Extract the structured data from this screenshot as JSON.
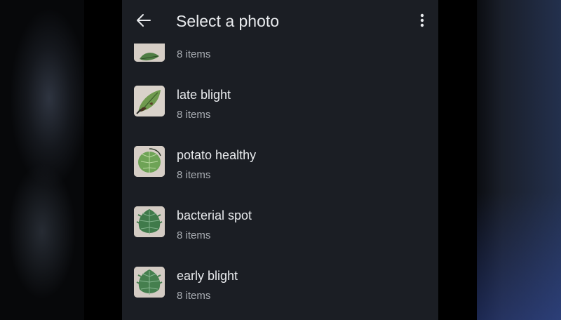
{
  "appbar": {
    "title": "Select a photo",
    "back_icon": "arrow-left-icon",
    "more_icon": "more-vert-icon"
  },
  "albums": [
    {
      "name": "",
      "count": "8 items",
      "thumb": "leaf-partial"
    },
    {
      "name": "late blight",
      "count": "8 items",
      "thumb": "leaf-late-blight"
    },
    {
      "name": "potato healthy",
      "count": "8 items",
      "thumb": "leaf-potato-healthy"
    },
    {
      "name": "bacterial spot",
      "count": "8 items",
      "thumb": "leaf-bacterial-spot"
    },
    {
      "name": "early blight",
      "count": "8 items",
      "thumb": "leaf-early-blight"
    }
  ],
  "colors": {
    "surface": "#1b1e24",
    "text_primary": "#e8eaed",
    "text_secondary": "#a9adb3",
    "thumb_bg": "#d6cec6",
    "leaf_green": "#4f8a4a"
  }
}
